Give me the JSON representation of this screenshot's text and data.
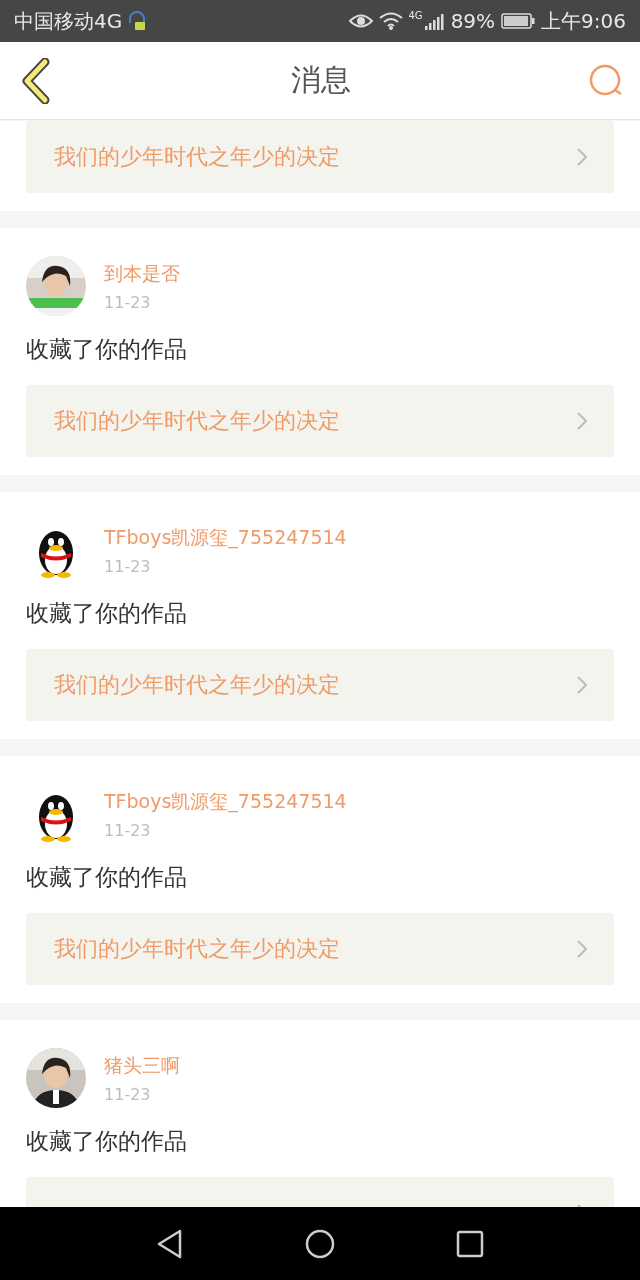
{
  "status_bar": {
    "carrier": "中国移动4G",
    "network": "4G",
    "battery": "89%",
    "time": "上午9:06"
  },
  "header": {
    "title": "消息"
  },
  "messages": [
    {
      "work": "我们的少年时代之年少的决定"
    },
    {
      "user": "到本是否",
      "date": "11-23",
      "action": "收藏了你的作品",
      "work": "我们的少年时代之年少的决定"
    },
    {
      "user": "TFboys凯源玺_755247514",
      "avatar": {
        "kind": "penguin"
      },
      "date": "11-23",
      "action": "收藏了你的作品",
      "work": "我们的少年时代之年少的决定"
    },
    {
      "user": "TFboys凯源玺_755247514",
      "avatar": {
        "kind": "penguin"
      },
      "date": "11-23",
      "action": "收藏了你的作品",
      "work": "我们的少年时代之年少的决定"
    },
    {
      "user": "猪头三啊",
      "date": "11-23",
      "action": "收藏了你的作品"
    }
  ]
}
